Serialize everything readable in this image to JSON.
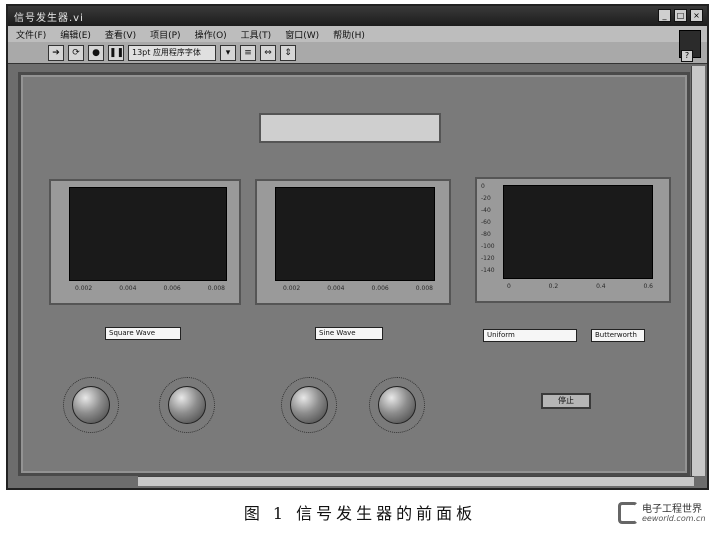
{
  "window": {
    "title": "信号发生器.vi"
  },
  "menu": [
    "文件(F)",
    "编辑(E)",
    "查看(V)",
    "项目(P)",
    "操作(O)",
    "工具(T)",
    "窗口(W)",
    "帮助(H)"
  ],
  "toolbar": {
    "font": "13pt 应用程序字体"
  },
  "graphs": [
    {
      "title": "",
      "xlabel": "",
      "xticks": [
        "0.002",
        "0.004",
        "0.006",
        "0.008"
      ],
      "yticks": []
    },
    {
      "title": "",
      "xlabel": "",
      "xticks": [
        "0.002",
        "0.004",
        "0.006",
        "0.008"
      ],
      "yticks": []
    },
    {
      "title": "",
      "xlabel": "",
      "xticks": [
        "0",
        "0.2",
        "0.4",
        "0.6"
      ],
      "yticks": [
        "0",
        "-20",
        "-40",
        "-60",
        "-80",
        "-100",
        "-120",
        "-140"
      ]
    }
  ],
  "controls": {
    "wave1": {
      "label": "",
      "value": "Square Wave"
    },
    "wave2": {
      "label": "",
      "value": "Sine Wave"
    },
    "noise": {
      "label": "",
      "value": "Uniform"
    },
    "filter": {
      "label": "",
      "value": "Butterworth"
    }
  },
  "knobs": [
    {
      "label": ""
    },
    {
      "label": ""
    },
    {
      "label": ""
    },
    {
      "label": ""
    }
  ],
  "stop": {
    "label": "停止"
  },
  "caption": "图 1 信号发生器的前面板",
  "watermark": {
    "name": "电子工程世界",
    "url": "eeworld.com.cn"
  }
}
